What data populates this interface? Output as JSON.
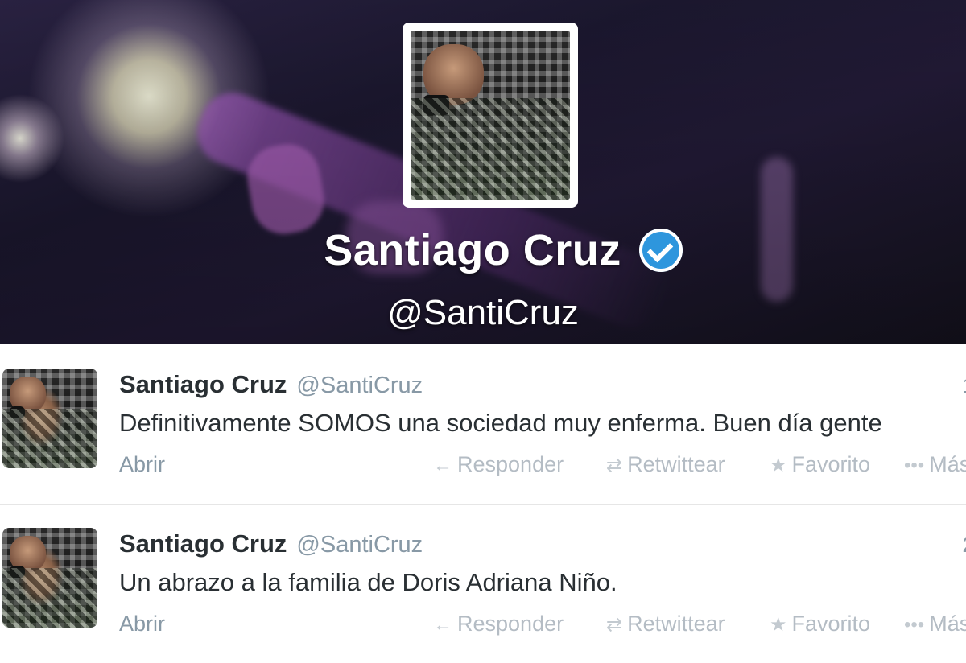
{
  "profile": {
    "name": "Santiago Cruz",
    "handle": "@SantiCruz"
  },
  "tweets": [
    {
      "name": "Santiago Cruz",
      "handle": "@SantiCruz",
      "time": "1",
      "text": "Definitivamente SOMOS una sociedad muy enferma. Buen día gente",
      "open": "Abrir",
      "reply": "Responder",
      "retweet": "Retwittear",
      "favorite": "Favorito",
      "more": "Más"
    },
    {
      "name": "Santiago Cruz",
      "handle": "@SantiCruz",
      "time": "2",
      "text": "Un abrazo a la familia de Doris Adriana Niño.",
      "open": "Abrir",
      "reply": "Responder",
      "retweet": "Retwittear",
      "favorite": "Favorito",
      "more": "Más"
    }
  ],
  "icons": {
    "verified": "verified-badge-icon",
    "reply": "reply-arrow-icon",
    "retweet": "retweet-icon",
    "favorite": "star-icon",
    "more": "ellipsis-icon"
  },
  "colors": {
    "verified": "#2e96dd",
    "text": "#292f33",
    "muted": "#8899a6"
  }
}
